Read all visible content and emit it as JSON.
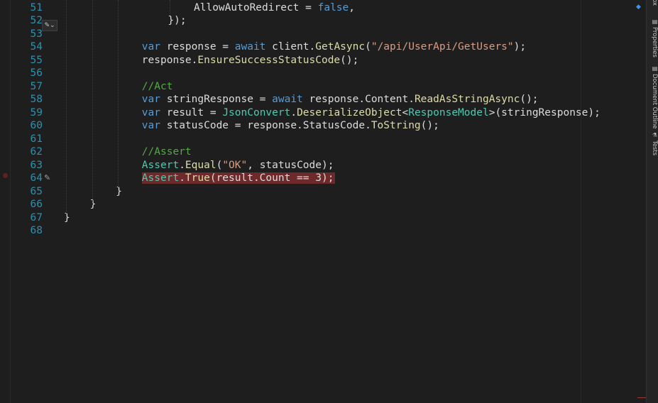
{
  "editor": {
    "line_numbers": [
      "51",
      "52",
      "53",
      "54",
      "55",
      "56",
      "57",
      "58",
      "59",
      "60",
      "61",
      "62",
      "63",
      "64",
      "65",
      "66",
      "67",
      "68"
    ],
    "lines": [
      {
        "indent": 20,
        "tokens": [
          {
            "t": "AllowAutoRedirect = ",
            "c": "pl"
          },
          {
            "t": "false",
            "c": "kw"
          },
          {
            "t": ",",
            "c": "pl"
          }
        ]
      },
      {
        "indent": 16,
        "tokens": [
          {
            "t": "});",
            "c": "pl"
          }
        ]
      },
      {
        "indent": 0,
        "tokens": []
      },
      {
        "indent": 12,
        "tokens": [
          {
            "t": "var",
            "c": "kw"
          },
          {
            "t": " response = ",
            "c": "pl"
          },
          {
            "t": "await",
            "c": "kw"
          },
          {
            "t": " client.",
            "c": "pl"
          },
          {
            "t": "GetAsync",
            "c": "mt"
          },
          {
            "t": "(",
            "c": "pl"
          },
          {
            "t": "\"/api/UserApi/GetUsers\"",
            "c": "st"
          },
          {
            "t": ");",
            "c": "pl"
          }
        ]
      },
      {
        "indent": 12,
        "tokens": [
          {
            "t": "response.",
            "c": "pl"
          },
          {
            "t": "EnsureSuccessStatusCode",
            "c": "mt"
          },
          {
            "t": "();",
            "c": "pl"
          }
        ]
      },
      {
        "indent": 0,
        "tokens": []
      },
      {
        "indent": 12,
        "tokens": [
          {
            "t": "//Act",
            "c": "cm"
          }
        ]
      },
      {
        "indent": 12,
        "tokens": [
          {
            "t": "var",
            "c": "kw"
          },
          {
            "t": " stringResponse = ",
            "c": "pl"
          },
          {
            "t": "await",
            "c": "kw"
          },
          {
            "t": " response.Content.",
            "c": "pl"
          },
          {
            "t": "ReadAsStringAsync",
            "c": "mt"
          },
          {
            "t": "();",
            "c": "pl"
          }
        ]
      },
      {
        "indent": 12,
        "tokens": [
          {
            "t": "var",
            "c": "kw"
          },
          {
            "t": " result = ",
            "c": "pl"
          },
          {
            "t": "JsonConvert",
            "c": "ty"
          },
          {
            "t": ".",
            "c": "pl"
          },
          {
            "t": "DeserializeObject",
            "c": "mt"
          },
          {
            "t": "<",
            "c": "pl"
          },
          {
            "t": "ResponseModel",
            "c": "ty"
          },
          {
            "t": ">(stringResponse);",
            "c": "pl"
          }
        ]
      },
      {
        "indent": 12,
        "tokens": [
          {
            "t": "var",
            "c": "kw"
          },
          {
            "t": " statusCode = response.StatusCode.",
            "c": "pl"
          },
          {
            "t": "ToString",
            "c": "mt"
          },
          {
            "t": "();",
            "c": "pl"
          }
        ]
      },
      {
        "indent": 0,
        "tokens": []
      },
      {
        "indent": 12,
        "tokens": [
          {
            "t": "//Assert",
            "c": "cm"
          }
        ]
      },
      {
        "indent": 12,
        "tokens": [
          {
            "t": "Assert",
            "c": "ty"
          },
          {
            "t": ".",
            "c": "pl"
          },
          {
            "t": "Equal",
            "c": "mt"
          },
          {
            "t": "(",
            "c": "pl"
          },
          {
            "t": "\"OK\"",
            "c": "st"
          },
          {
            "t": ", statusCode);",
            "c": "pl"
          }
        ]
      },
      {
        "indent": 12,
        "breakpoint": true,
        "tokens": [
          {
            "t": "Assert",
            "c": "ty"
          },
          {
            "t": ".",
            "c": "pl"
          },
          {
            "t": "True",
            "c": "mt"
          },
          {
            "t": "(result.Count == 3);",
            "c": "pl"
          }
        ]
      },
      {
        "indent": 8,
        "tokens": [
          {
            "t": "}",
            "c": "pl"
          }
        ]
      },
      {
        "indent": 4,
        "tokens": [
          {
            "t": "}",
            "c": "pl"
          }
        ]
      },
      {
        "indent": 0,
        "tokens": [
          {
            "t": "}",
            "c": "pl"
          }
        ]
      },
      {
        "indent": 0,
        "tokens": []
      }
    ],
    "quick_action_glyph": "✎⌄",
    "edit_glyph": "✎"
  },
  "right_rail": {
    "tabs": [
      {
        "icon": "▤",
        "label": "Properties"
      },
      {
        "icon": "▤",
        "label": "Document Outline"
      },
      {
        "icon": "⚗",
        "label": "Tests"
      }
    ],
    "top_fragment": "ox"
  },
  "colors": {
    "background": "#1e1e1e",
    "line_number": "#2b91af",
    "keyword": "#569cd6",
    "method": "#dcdcaa",
    "string": "#d69d85",
    "comment": "#57a64a",
    "type": "#4ec9b0",
    "breakpoint_highlight": "#6e2a2a"
  }
}
